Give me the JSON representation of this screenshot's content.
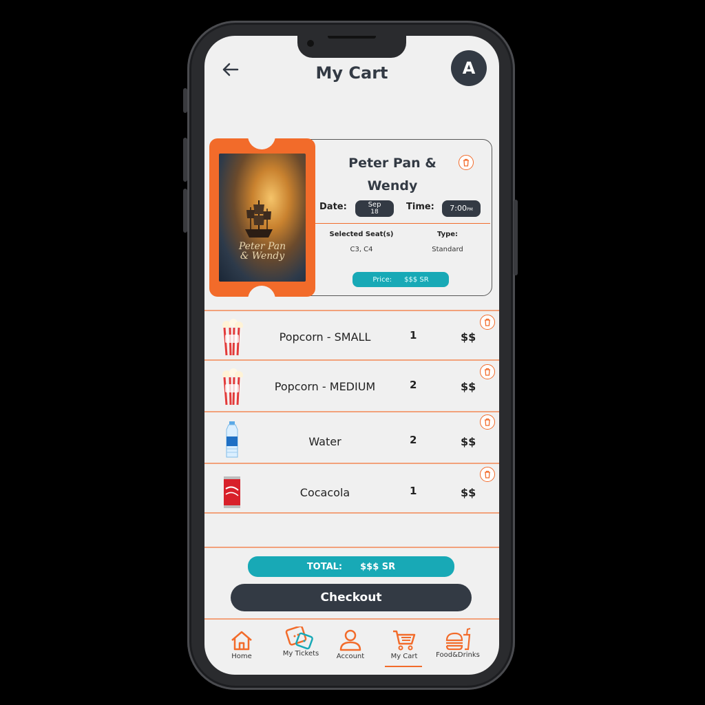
{
  "header": {
    "title": "My Cart",
    "avatar_letter": "A"
  },
  "movie": {
    "poster_title": "PETER PAN & WENDY",
    "name": "Peter Pan & Wendy",
    "date_label": "Date:",
    "date_month": "Sep",
    "date_day": "18",
    "time_label": "Time:",
    "time_value": "7:00",
    "time_suffix": "PM",
    "seats_label": "Selected Seat(s)",
    "seats_value": "C3, C4",
    "type_label": "Type:",
    "type_value": "Standard",
    "price_label": "Price:",
    "price_value": "$$$ SR"
  },
  "items": [
    {
      "name": "Popcorn - SMALL",
      "qty": "1",
      "price": "$$",
      "icon": "popcorn-icon"
    },
    {
      "name": "Popcorn - MEDIUM",
      "qty": "2",
      "price": "$$",
      "icon": "popcorn-icon"
    },
    {
      "name": "Water",
      "qty": "2",
      "price": "$$",
      "icon": "water-bottle-icon"
    },
    {
      "name": "Cocacola",
      "qty": "1",
      "price": "$$",
      "icon": "soda-can-icon"
    }
  ],
  "total": {
    "label": "TOTAL:",
    "value": "$$$ SR"
  },
  "checkout_label": "Checkout",
  "nav": [
    {
      "label": "Home",
      "icon": "home-icon"
    },
    {
      "label": "My Tickets",
      "icon": "tickets-icon"
    },
    {
      "label": "Account",
      "icon": "account-icon"
    },
    {
      "label": "My Cart",
      "icon": "cart-icon",
      "active": true
    },
    {
      "label": "Food&Drinks",
      "icon": "food-drinks-icon"
    }
  ],
  "colors": {
    "accent": "#f26b2a",
    "teal": "#18a9b6",
    "dark": "#333a44",
    "bg": "#f0f0f0"
  }
}
